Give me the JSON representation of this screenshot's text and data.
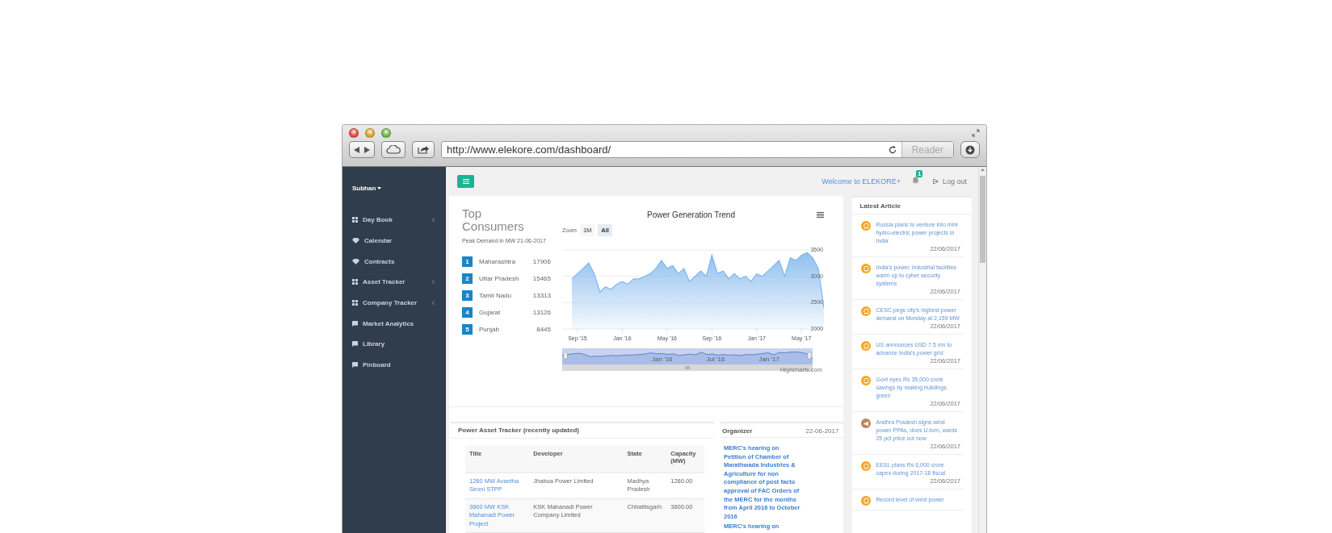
{
  "browser": {
    "url": "http://www.elekore.com/dashboard/",
    "reader_label": "Reader"
  },
  "sidebar": {
    "user": "Subhan",
    "items": [
      {
        "label": "Day Book",
        "kind": "menu"
      },
      {
        "label": "Calendar",
        "kind": "page"
      },
      {
        "label": "Contracts",
        "kind": "page"
      },
      {
        "label": "Asset Tracker",
        "kind": "menu"
      },
      {
        "label": "Company Tracker",
        "kind": "menu"
      },
      {
        "label": "Market Analytics",
        "kind": "resource"
      },
      {
        "label": "Library",
        "kind": "resource"
      },
      {
        "label": "Pinboard",
        "kind": "resource"
      }
    ]
  },
  "topbar": {
    "welcome": "Welcome to ELEKORE+",
    "notifications": "1",
    "logout": "Log out"
  },
  "top_consumers": {
    "title": "Top Consumers",
    "subtitle": "Peak Demand in MW 21-06-2017",
    "rows": [
      {
        "rank": "1",
        "state": "Maharashtra",
        "value": "17906"
      },
      {
        "rank": "2",
        "state": "Uttar Pradesh",
        "value": "15465"
      },
      {
        "rank": "3",
        "state": "Tamil Nadu",
        "value": "13313"
      },
      {
        "rank": "4",
        "state": "Gujarat",
        "value": "13126"
      },
      {
        "rank": "5",
        "state": "Punjab",
        "value": "8445"
      }
    ]
  },
  "trend": {
    "zoom_label": "Zoom",
    "zoom_buttons": [
      {
        "label": "1M",
        "selected": false
      },
      {
        "label": "All",
        "selected": true
      }
    ],
    "navigator_labels": [
      "Jan '16",
      "Jul '16",
      "Jan '17"
    ],
    "credit": "Highcharts.com",
    "chart_data": {
      "type": "area",
      "title": "Power Generation Trend",
      "categories": [
        null,
        "Sep '15",
        null,
        null,
        null,
        null,
        null,
        null,
        null,
        "Jan '16",
        null,
        null,
        null,
        null,
        null,
        null,
        null,
        "May '16",
        null,
        null,
        null,
        null,
        null,
        null,
        null,
        "Sep '16",
        null,
        null,
        null,
        null,
        null,
        null,
        null,
        "Jan '17",
        null,
        null,
        null,
        null,
        null,
        null,
        null,
        "May '17",
        null,
        null,
        null,
        null
      ],
      "series": [
        {
          "color": "#7cb5ec",
          "values": [
            2950,
            3050,
            3150,
            3250,
            3050,
            2700,
            2800,
            2750,
            2850,
            2900,
            2850,
            2950,
            2950,
            3000,
            3050,
            3150,
            3300,
            3150,
            3200,
            3050,
            3150,
            2900,
            3000,
            3100,
            3000,
            3400,
            3050,
            3100,
            2950,
            3050,
            2950,
            3000,
            2900,
            3050,
            3000,
            3100,
            3200,
            3300,
            3000,
            3350,
            3300,
            3400,
            3450,
            3350,
            3150,
            2400
          ]
        }
      ],
      "ylim": [
        2000,
        3500
      ],
      "grid": true,
      "yticks": [
        2000,
        2500,
        3000,
        3500
      ]
    }
  },
  "asset_tracker": {
    "title": "Power Asset Tracker (recently updated)",
    "columns": [
      "Title",
      "Developer",
      "State",
      "Capacity (MW)"
    ],
    "rows": [
      [
        "1260 MW Avantha Seoni STPP",
        "Jhabua Power Limited",
        "Madhya Pradesh",
        "1260.00"
      ],
      [
        "3600 MW KSK Mahanadi Power Project",
        "KSK Mahanadi Power Company Limited",
        "Chhattisgarh",
        "3600.00"
      ]
    ]
  },
  "organizer": {
    "title": "Organizer",
    "date": "22-06-2017",
    "events": [
      "MERC's hearing on Petition of Chamber of Marathwada Industries & Agriculture for non compliance of post facto approval of FAC Orders of the MERC for the months from April 2016 to October 2016",
      "MERC's hearing on"
    ]
  },
  "latest_article": {
    "title": "Latest Article",
    "items": [
      {
        "title": "Russia plans to venture into mini hydro-electric power projects in India",
        "date": "22/06/2017",
        "kind": "news",
        "color": "#f5a623"
      },
      {
        "title": "India's power, industrial facilities warm up to cyber security systems",
        "date": "22/06/2017",
        "kind": "news",
        "color": "#f5a623"
      },
      {
        "title": "CESC pegs city's highest power demand on Monday at 2,159 MW",
        "date": "22/06/2017",
        "kind": "news",
        "color": "#f5a623"
      },
      {
        "title": "US announces USD 7.5 mn to advance India's power grid",
        "date": "22/06/2017",
        "kind": "news",
        "color": "#f5a623"
      },
      {
        "title": "Govt eyes Rs 35,000 crore savings by making buildings green",
        "date": "22/06/2017",
        "kind": "news",
        "color": "#f5a623"
      },
      {
        "title": "Andhra Pradesh signs wind power PPAs, does U-turn, wants 25 pct price cut now",
        "date": "22/06/2017",
        "kind": "announcement",
        "color": "#b8865a"
      },
      {
        "title": "EESL plans Rs 6,000 crore capex during 2017-18 fiscal",
        "date": "22/06/2017",
        "kind": "news",
        "color": "#f5a623"
      },
      {
        "title": "Record level of wind power",
        "kind": "news",
        "color": "#f5a623"
      }
    ]
  }
}
